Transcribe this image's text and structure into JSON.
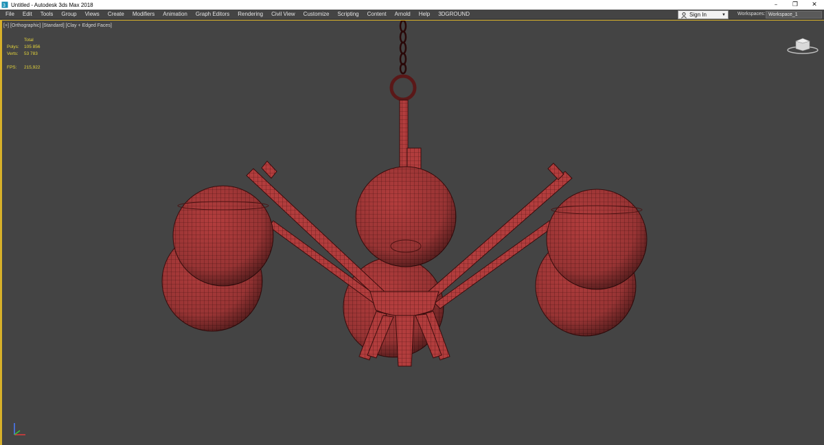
{
  "window": {
    "title": "Untitled - Autodesk 3ds Max 2018",
    "controls": {
      "minimize": "–",
      "restore": "❐",
      "close": "✕"
    }
  },
  "menubar": {
    "items": [
      "File",
      "Edit",
      "Tools",
      "Group",
      "Views",
      "Create",
      "Modifiers",
      "Animation",
      "Graph Editors",
      "Rendering",
      "Civil View",
      "Customize",
      "Scripting",
      "Content",
      "Arnold",
      "Help",
      "3DGROUND"
    ],
    "sign_in": "Sign In",
    "workspaces_label": "Workspaces:",
    "workspace_value": "Workspace_1"
  },
  "viewport": {
    "label_parts": [
      "[+]",
      "[Orthographic]",
      "[Standard]",
      "[Clay + Edged Faces]"
    ],
    "stats": {
      "header": "Total",
      "polys_label": "Polys:",
      "polys_value": "105 856",
      "verts_label": "Verts:",
      "verts_value": "53 783",
      "fps_label": "FPS:",
      "fps_value": "215,922"
    },
    "colors": {
      "accent_border": "#d8b12a",
      "stats_text": "#e7d63a",
      "model_fill": "#b13a3a",
      "wire": "#3a0d0d"
    },
    "icons": [
      "viewcube-icon",
      "axis-gizmo-icon"
    ]
  }
}
